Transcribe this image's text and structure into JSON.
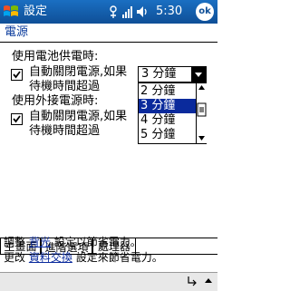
{
  "window": {
    "title": "設定",
    "time": "5:30",
    "ok_label": "ok"
  },
  "status_icons": [
    "connectivity-icon",
    "signal-icon",
    "volume-icon"
  ],
  "page_title": "電源",
  "battery": {
    "heading": "使用電池供電時:",
    "checkbox_line1": "自動關閉電源,如果",
    "checkbox_line2": "待機時間超過",
    "checked": true
  },
  "external": {
    "heading": "使用外接電源時:",
    "checkbox_line1": "自動關閉電源,如果",
    "checkbox_line2": "待機時間超過",
    "checked": true
  },
  "dropdown": {
    "selected": "3 分鐘",
    "options": [
      "2 分鐘",
      "3 分鐘",
      "4 分鐘",
      "5 分鐘"
    ],
    "highlighted_index": 1
  },
  "tabs": [
    "主畫面",
    "進階選項",
    "處理器"
  ],
  "active_tab": 1,
  "footer": {
    "line1_prefix": "調整",
    "line1_link": "背光",
    "line1_suffix": "設定以節省電力。",
    "line2_prefix": "更改",
    "line2_link": "資料交換",
    "line2_suffix": "設定來節省電力。"
  },
  "colors": {
    "titlebar": "#1a6fc2",
    "accent": "#0a2a9c"
  }
}
